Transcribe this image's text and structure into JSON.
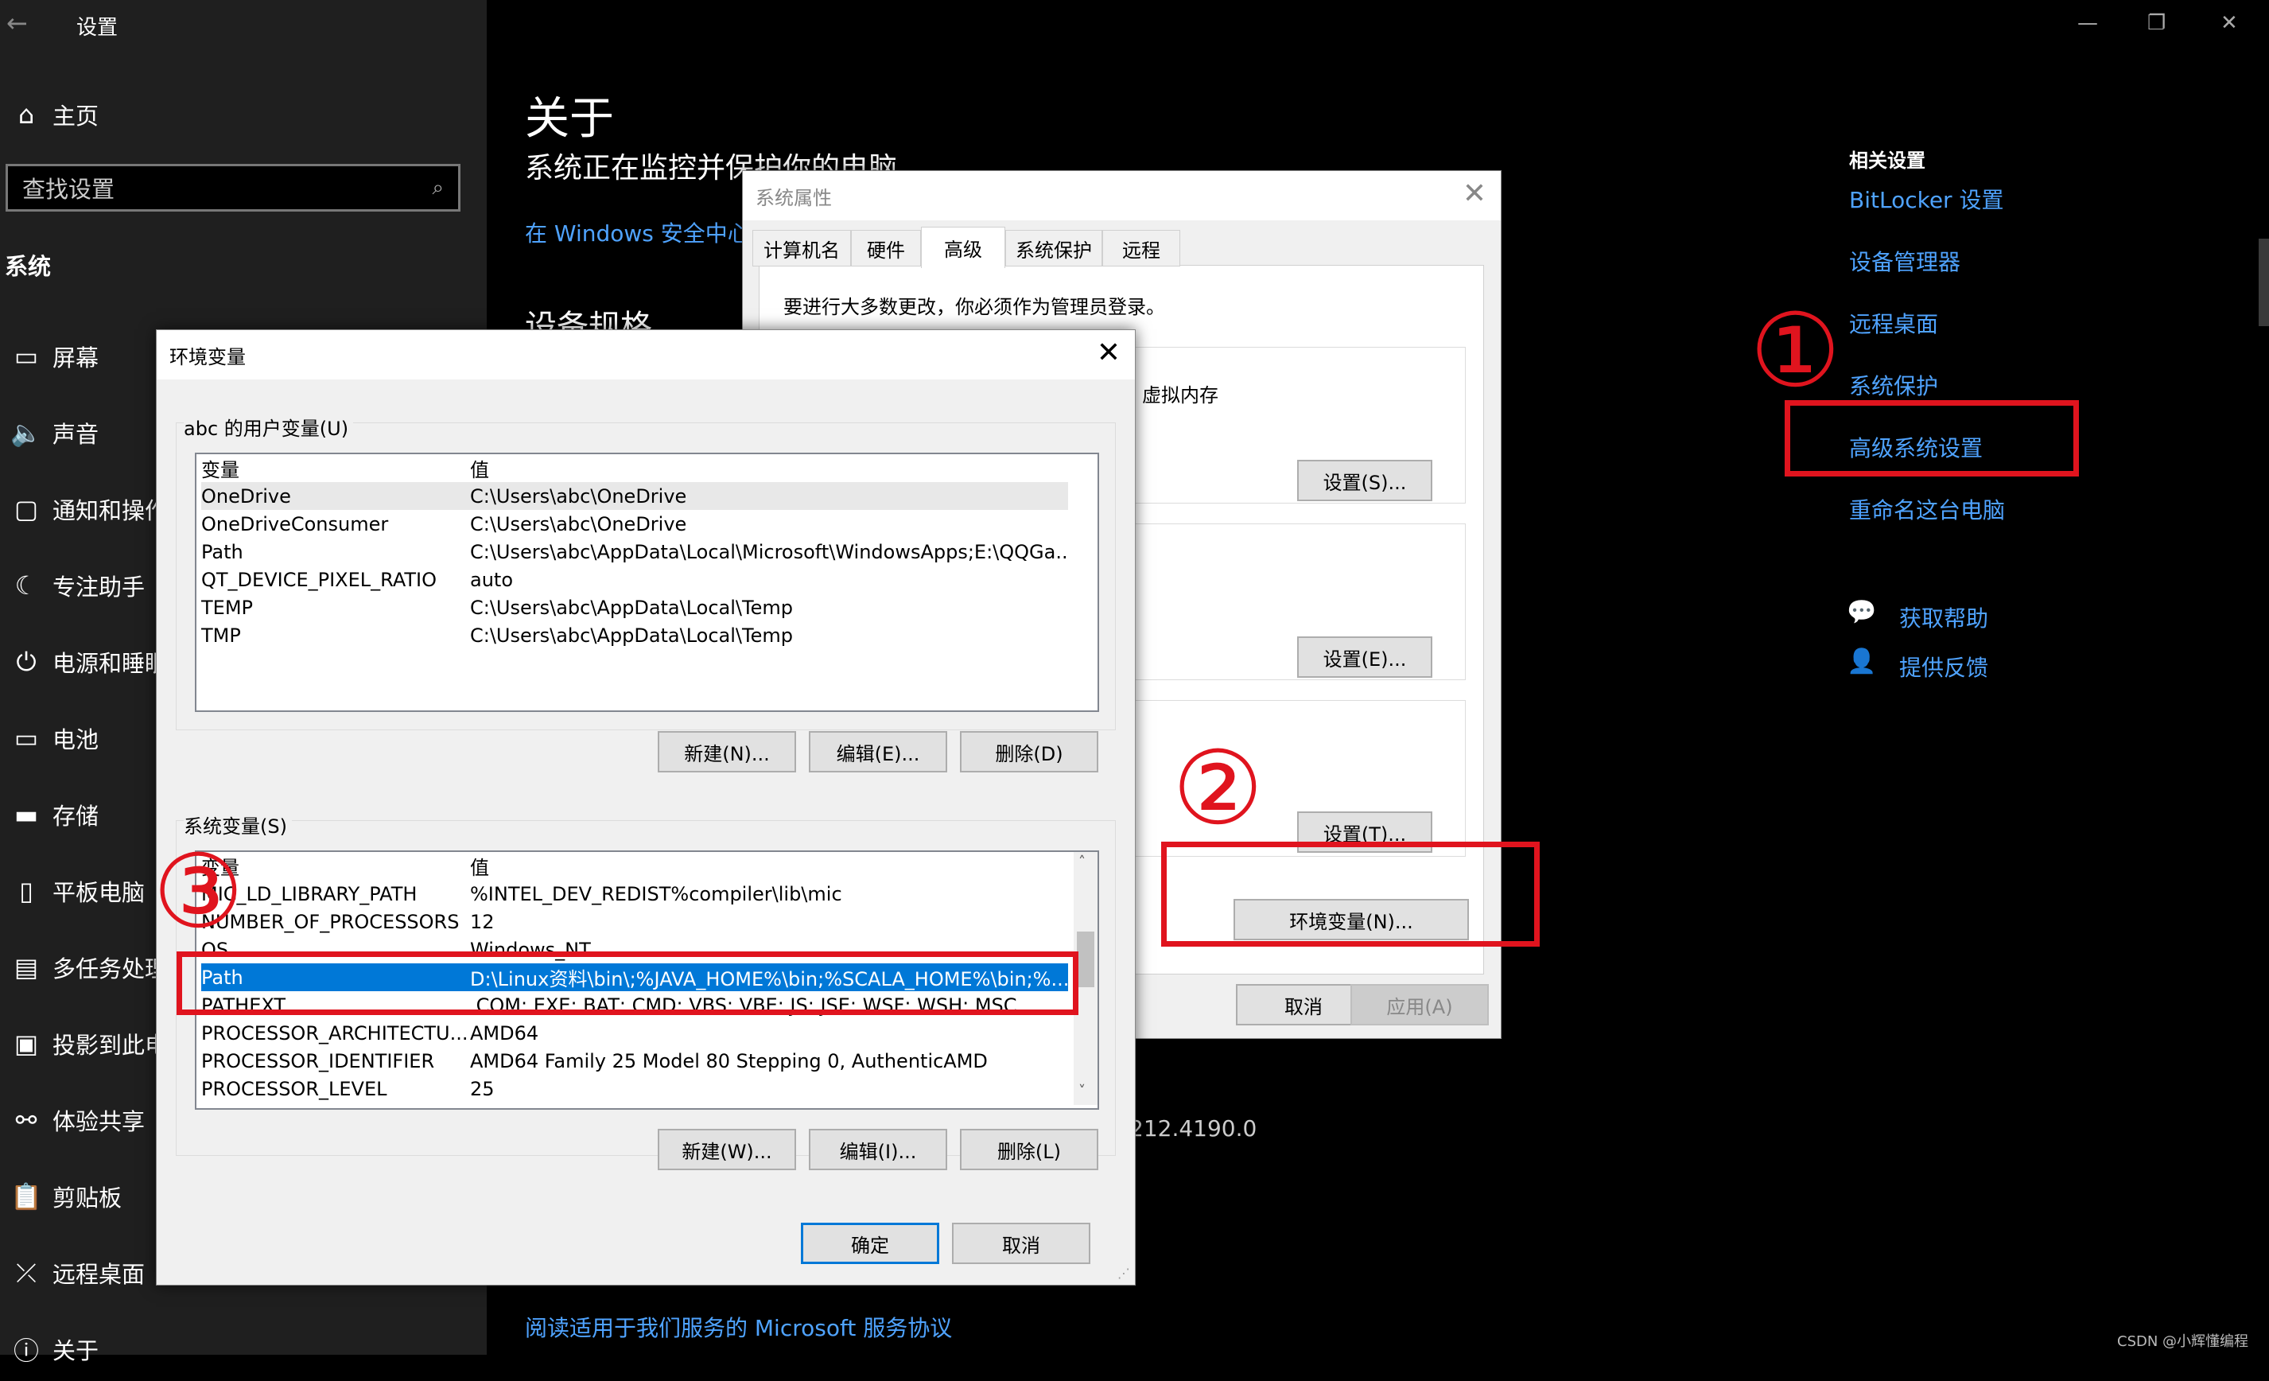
{
  "settings": {
    "window_title": "设置",
    "home": "主页",
    "search_placeholder": "查找设置",
    "section": "系统",
    "sidebar_items": [
      {
        "label": "屏幕",
        "icon": "monitor-icon"
      },
      {
        "label": "声音",
        "icon": "speaker-icon"
      },
      {
        "label": "通知和操作",
        "icon": "notification-icon"
      },
      {
        "label": "专注助手",
        "icon": "moon-icon"
      },
      {
        "label": "电源和睡眠",
        "icon": "power-icon"
      },
      {
        "label": "电池",
        "icon": "battery-icon"
      },
      {
        "label": "存储",
        "icon": "storage-icon"
      },
      {
        "label": "平板电脑",
        "icon": "tablet-icon"
      },
      {
        "label": "多任务处理",
        "icon": "multitask-icon"
      },
      {
        "label": "投影到此电脑",
        "icon": "project-icon"
      },
      {
        "label": "体验共享",
        "icon": "share-icon"
      },
      {
        "label": "剪贴板",
        "icon": "clipboard-icon"
      },
      {
        "label": "远程桌面",
        "icon": "remote-icon"
      },
      {
        "label": "关于",
        "icon": "info-icon"
      }
    ],
    "main_title": "关于",
    "main_subtitle": "系统正在监控并保护你的电脑。",
    "security_link": "在 Windows 安全中心",
    "specs_heading": "设备规格",
    "version_fragment": "212.4190.0",
    "agreement_link": "阅读适用于我们服务的 Microsoft 服务协议",
    "related_heading": "相关设置",
    "related_links": [
      "BitLocker 设置",
      "设备管理器",
      "远程桌面",
      "系统保护",
      "高级系统设置",
      "重命名这台电脑"
    ],
    "help_link": "获取帮助",
    "feedback_link": "提供反馈",
    "watermark": "CSDN @小辉懂编程"
  },
  "sysprops": {
    "title": "系统属性",
    "tabs": [
      "计算机名",
      "硬件",
      "高级",
      "系统保护",
      "远程"
    ],
    "admin_note": "要进行大多数更改，你必须作为管理员登录。",
    "perf_fragment": "虚拟内存",
    "btn_settings_s": "设置(S)...",
    "btn_settings_e": "设置(E)...",
    "btn_settings_t": "设置(T)...",
    "btn_env": "环境变量(N)...",
    "btn_cancel": "取消",
    "btn_apply": "应用(A)"
  },
  "envvars": {
    "title": "环境变量",
    "user_group": "abc 的用户变量(U)",
    "col_var": "变量",
    "col_val": "值",
    "user_rows": [
      {
        "name": "OneDrive",
        "value": "C:\\Users\\abc\\OneDrive"
      },
      {
        "name": "OneDriveConsumer",
        "value": "C:\\Users\\abc\\OneDrive"
      },
      {
        "name": "Path",
        "value": "C:\\Users\\abc\\AppData\\Local\\Microsoft\\WindowsApps;E:\\QQGa..."
      },
      {
        "name": "QT_DEVICE_PIXEL_RATIO",
        "value": "auto"
      },
      {
        "name": "TEMP",
        "value": "C:\\Users\\abc\\AppData\\Local\\Temp"
      },
      {
        "name": "TMP",
        "value": "C:\\Users\\abc\\AppData\\Local\\Temp"
      }
    ],
    "user_btn_new": "新建(N)...",
    "user_btn_edit": "编辑(E)...",
    "user_btn_delete": "删除(D)",
    "sys_group": "系统变量(S)",
    "sys_rows": [
      {
        "name": "MIC_LD_LIBRARY_PATH",
        "value": "%INTEL_DEV_REDIST%compiler\\lib\\mic"
      },
      {
        "name": "NUMBER_OF_PROCESSORS",
        "value": "12"
      },
      {
        "name": "OS",
        "value": "Windows_NT"
      },
      {
        "name": "Path",
        "value": "D:\\Linux资料\\bin\\;%JAVA_HOME%\\bin;%SCALA_HOME%\\bin;%..."
      },
      {
        "name": "PATHEXT",
        "value": ".COM;.EXE;.BAT;.CMD;.VBS;.VBE;.JS;.JSE;.WSF;.WSH;.MSC"
      },
      {
        "name": "PROCESSOR_ARCHITECTU...",
        "value": "AMD64"
      },
      {
        "name": "PROCESSOR_IDENTIFIER",
        "value": "AMD64 Family 25 Model 80 Stepping 0, AuthenticAMD"
      },
      {
        "name": "PROCESSOR_LEVEL",
        "value": "25"
      }
    ],
    "sys_btn_new": "新建(W)...",
    "sys_btn_edit": "编辑(I)...",
    "sys_btn_delete": "删除(L)",
    "btn_ok": "确定",
    "btn_cancel": "取消"
  },
  "annotations": [
    "①",
    "②",
    "③"
  ],
  "colors": {
    "accent": "#0078d7",
    "link": "#4fa3ff",
    "annotation": "#e0141e"
  }
}
